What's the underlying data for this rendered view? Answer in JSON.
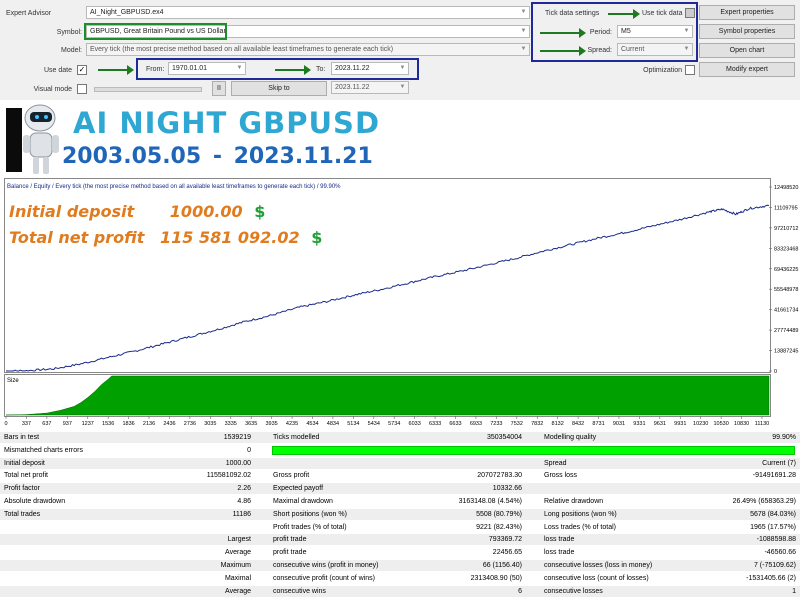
{
  "settings": {
    "expert_label": "Expert Advisor",
    "expert_value": "AI_Night_GBPUSD.ex4",
    "symbol_label": "Symbol:",
    "symbol_value": "GBPUSD, Great Britain Pound vs US Dollar",
    "model_label": "Model:",
    "model_value": "Every tick (the most precise method based on all available least timeframes to generate each tick)",
    "use_date_label": "Use date",
    "use_date_checked": "✓",
    "from_label": "From:",
    "from_value": "1970.01.01",
    "to_label": "To:",
    "to_value": "2023.11.22",
    "visual_label": "Visual mode",
    "pause_label": "II",
    "skip_label": "Skip to",
    "skip_value": "2023.11.22",
    "tick_data_settings": "Tick data settings",
    "use_tick_data": "Use tick data",
    "period_label": "Period:",
    "period_value": "M5",
    "spread_label": "Spread:",
    "spread_value": "Current",
    "optimization_label": "Optimization",
    "expert_properties": "Expert properties",
    "symbol_properties": "Symbol properties",
    "open_chart": "Open chart",
    "modify_expert": "Modify expert"
  },
  "banner": {
    "title": "AI NIGHT GBPUSD",
    "dates": "2003.05.05  - 2023.11.21"
  },
  "chart": {
    "header": "Balance / Equity / Every tick (the most precise method based on all available least timeframes to generate each tick) / 99.90%",
    "size_label": "Size",
    "initial_deposit_label": "Initial deposit",
    "initial_deposit_value": "1000.00",
    "total_profit_label": "Total net profit",
    "total_profit_value": "115 581 092.02",
    "currency": "$",
    "colors": {
      "balance": "#1a2a8a",
      "size_fill": "#00a000",
      "profit_text": "#e07b1e",
      "dollar": "#22a035"
    }
  },
  "chart_data": {
    "type": "line",
    "title": "",
    "xlabel": "",
    "ylabel": "",
    "x_ticks": [
      "0",
      "337",
      "637",
      "937",
      "1237",
      "1536",
      "1836",
      "2136",
      "2436",
      "2736",
      "3035",
      "3335",
      "3635",
      "3935",
      "4235",
      "4534",
      "4834",
      "5134",
      "5434",
      "5734",
      "6033",
      "6333",
      "6633",
      "6933",
      "7233",
      "7532",
      "7832",
      "8132",
      "8432",
      "8731",
      "9031",
      "9331",
      "9631",
      "9931",
      "10230",
      "10530",
      "10830",
      "11130"
    ],
    "y_ticks": [
      "12498520",
      "11109795",
      "97210712",
      "83323468",
      "69436225",
      "55548978",
      "41661734",
      "27774489",
      "13887245",
      "0"
    ],
    "ylim": [
      0,
      125000000
    ],
    "xlim": [
      0,
      11186
    ],
    "series": [
      {
        "x": [
          0,
          300,
          700,
          1100,
          1500,
          1900,
          2300,
          2700,
          3100,
          3500,
          3900,
          4300,
          4700,
          5100,
          5500,
          5900,
          6300,
          6700,
          7100,
          7500,
          7900,
          8300,
          8700,
          9100,
          9500,
          9900,
          10300,
          10500,
          10700,
          10900,
          11186
        ],
        "values": [
          1000,
          200000,
          1500000,
          5000000,
          9500000,
          14000000,
          19000000,
          24000000,
          29000000,
          34500000,
          39000000,
          44500000,
          48500000,
          53000000,
          57000000,
          61500000,
          66000000,
          70000000,
          74500000,
          79000000,
          84000000,
          88500000,
          93000000,
          97000000,
          101500000,
          106000000,
          111000000,
          113000000,
          109500000,
          113500000,
          115582092
        ]
      }
    ],
    "size_series": {
      "name": "Size",
      "x": [
        0,
        300,
        600,
        800,
        1000,
        1100,
        1200,
        1300,
        1400,
        1500,
        1550,
        11186
      ],
      "values": [
        0,
        0.01,
        0.05,
        0.12,
        0.22,
        0.32,
        0.45,
        0.6,
        0.78,
        0.92,
        1.0,
        1.0
      ]
    }
  },
  "results": {
    "rows": [
      {
        "c1": "Bars in test",
        "v1": "1539219",
        "c2": "Ticks modelled",
        "v2": "350354004",
        "c3": "Modelling quality",
        "v3": "99.90%"
      },
      {
        "c1": "Mismatched charts errors",
        "v1": "0",
        "c2": "",
        "v2": "",
        "c3": "",
        "v3": ""
      },
      {
        "c1": "Initial deposit",
        "v1": "1000.00",
        "c2": "",
        "v2": "",
        "c3": "Spread",
        "v3": "Current (7)"
      },
      {
        "c1": "Total net profit",
        "v1": "115581092.02",
        "c2": "Gross profit",
        "v2": "207072783.30",
        "c3": "Gross loss",
        "v3": "-91491691.28"
      },
      {
        "c1": "Profit factor",
        "v1": "2.26",
        "c2": "Expected payoff",
        "v2": "10332.66",
        "c3": "",
        "v3": ""
      },
      {
        "c1": "Absolute drawdown",
        "v1": "4.86",
        "c2": "Maximal drawdown",
        "v2": "3163148.08 (4.54%)",
        "c3": "Relative drawdown",
        "v3": "26.49% (658363.29)"
      },
      {
        "c1": "Total trades",
        "v1": "11186",
        "c2": "Short positions (won %)",
        "v2": "5508 (80.79%)",
        "c3": "Long positions (won %)",
        "v3": "5678 (84.03%)"
      },
      {
        "c1": "",
        "v1": "",
        "c2": "Profit trades (% of total)",
        "v2": "9221 (82.43%)",
        "c3": "Loss trades (% of total)",
        "v3": "1965 (17.57%)"
      },
      {
        "c1": "",
        "v1": "Largest",
        "c2": "profit trade",
        "v2": "793369.72",
        "c3": "loss trade",
        "v3": "-1088598.88"
      },
      {
        "c1": "",
        "v1": "Average",
        "c2": "profit trade",
        "v2": "22456.65",
        "c3": "loss trade",
        "v3": "-46560.66"
      },
      {
        "c1": "",
        "v1": "Maximum",
        "c2": "consecutive wins (profit in money)",
        "v2": "66 (1156.40)",
        "c3": "consecutive losses (loss in money)",
        "v3": "7 (-75109.62)"
      },
      {
        "c1": "",
        "v1": "Maximal",
        "c2": "consecutive profit (count of wins)",
        "v2": "2313408.90 (50)",
        "c3": "consecutive loss (count of losses)",
        "v3": "-1531405.66 (2)"
      },
      {
        "c1": "",
        "v1": "Average",
        "c2": "consecutive wins",
        "v2": "6",
        "c3": "consecutive losses",
        "v3": "1"
      }
    ],
    "modelling_quality_fraction": 0.999
  }
}
